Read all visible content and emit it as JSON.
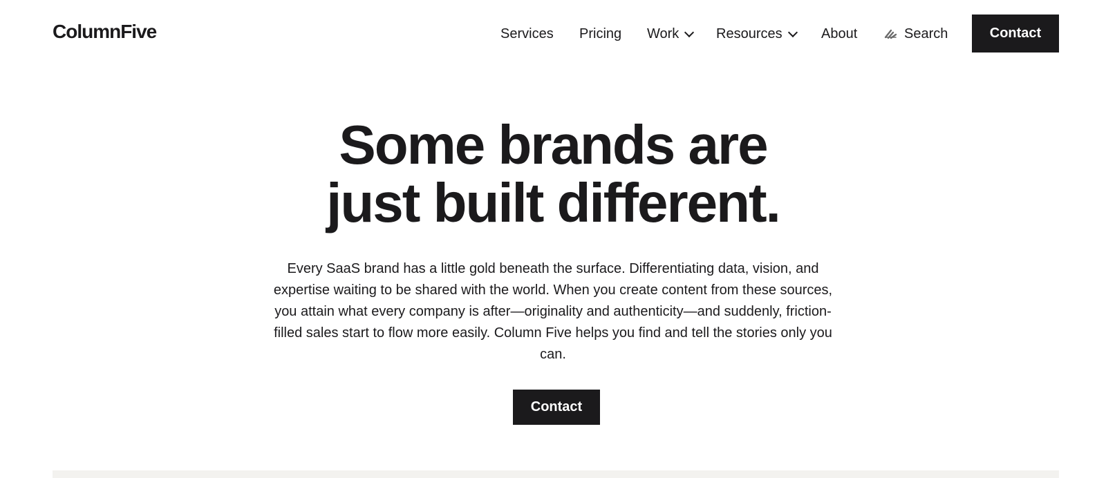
{
  "header": {
    "logo": "ColumnFive",
    "nav": {
      "services": "Services",
      "pricing": "Pricing",
      "work": "Work",
      "resources": "Resources",
      "about": "About",
      "search": "Search"
    },
    "contact_label": "Contact"
  },
  "hero": {
    "headline_line1": "Some brands are",
    "headline_line2": "just built different.",
    "intro": "Every SaaS brand has a little gold beneath the surface. Differentiating data, vision, and expertise waiting to be shared with the world. When you create content from these sources, you attain what every company is after—originality and authenticity—and suddenly, friction-filled sales start to flow more easily. Column Five helps you find and tell the stories only you can.",
    "cta_label": "Contact"
  },
  "colors": {
    "text": "#1b1a1c",
    "button_bg": "#1b1a1c",
    "button_text": "#ffffff",
    "background": "#ffffff",
    "band": "#f3f2ef"
  },
  "icons": {
    "search": "search-icon",
    "dropdown": "chevron-down-icon"
  }
}
